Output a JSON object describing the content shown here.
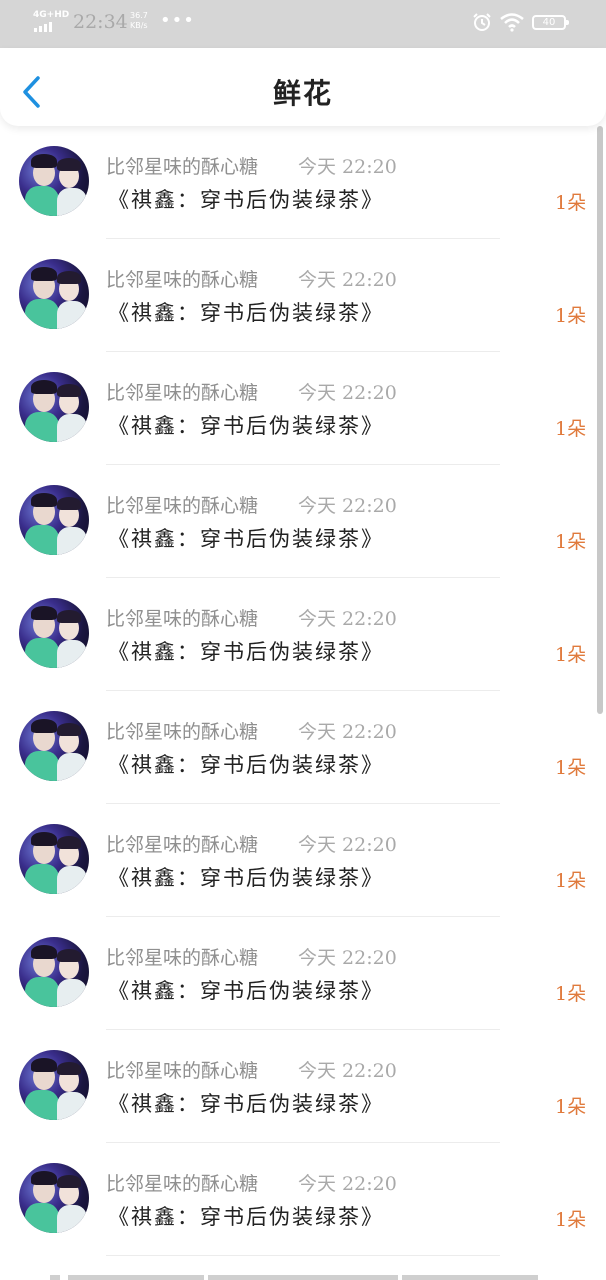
{
  "status_bar": {
    "network": "4G+HD",
    "time": "22:34",
    "speed_value": "36.7",
    "speed_unit": "KB/s",
    "more": "•••",
    "battery": "40"
  },
  "header": {
    "title": "鲜花"
  },
  "records": [
    {
      "username": "比邻星味的酥心糖",
      "time": "今天 22:20",
      "book": "《祺鑫：穿书后伪装绿茶》",
      "count": "1朵"
    },
    {
      "username": "比邻星味的酥心糖",
      "time": "今天 22:20",
      "book": "《祺鑫：穿书后伪装绿茶》",
      "count": "1朵"
    },
    {
      "username": "比邻星味的酥心糖",
      "time": "今天 22:20",
      "book": "《祺鑫：穿书后伪装绿茶》",
      "count": "1朵"
    },
    {
      "username": "比邻星味的酥心糖",
      "time": "今天 22:20",
      "book": "《祺鑫：穿书后伪装绿茶》",
      "count": "1朵"
    },
    {
      "username": "比邻星味的酥心糖",
      "time": "今天 22:20",
      "book": "《祺鑫：穿书后伪装绿茶》",
      "count": "1朵"
    },
    {
      "username": "比邻星味的酥心糖",
      "time": "今天 22:20",
      "book": "《祺鑫：穿书后伪装绿茶》",
      "count": "1朵"
    },
    {
      "username": "比邻星味的酥心糖",
      "time": "今天 22:20",
      "book": "《祺鑫：穿书后伪装绿茶》",
      "count": "1朵"
    },
    {
      "username": "比邻星味的酥心糖",
      "time": "今天 22:20",
      "book": "《祺鑫：穿书后伪装绿茶》",
      "count": "1朵"
    },
    {
      "username": "比邻星味的酥心糖",
      "time": "今天 22:20",
      "book": "《祺鑫：穿书后伪装绿茶》",
      "count": "1朵"
    },
    {
      "username": "比邻星味的酥心糖",
      "time": "今天 22:20",
      "book": "《祺鑫：穿书后伪装绿茶》",
      "count": "1朵"
    }
  ],
  "colors": {
    "accent_blue": "#1e90e0",
    "count_orange": "#e07a3c",
    "status_bar_bg": "#d6d6d6"
  },
  "icons": {
    "back": "chevron-left-icon",
    "alarm": "alarm-icon",
    "wifi": "wifi-icon",
    "battery": "battery-icon",
    "signal": "signal-icon"
  }
}
